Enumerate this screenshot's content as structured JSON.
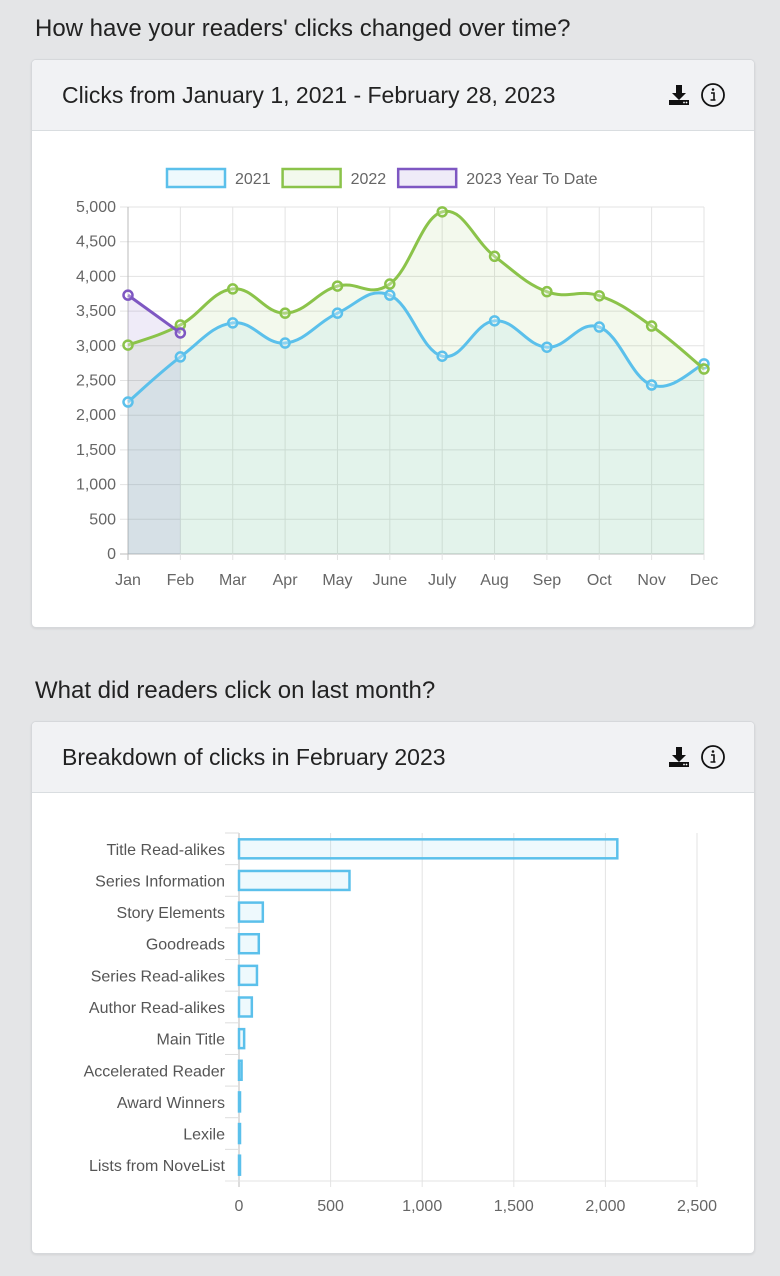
{
  "sections": [
    {
      "heading": "How have your readers' clicks changed over time?",
      "card_title": "Clicks from January 1, 2021 - February 28, 2023",
      "icons": [
        "download-icon",
        "info-icon"
      ]
    },
    {
      "heading": "What did readers click on last month?",
      "card_title": "Breakdown of clicks in February 2023",
      "icons": [
        "download-icon",
        "info-icon"
      ]
    }
  ],
  "chart_data": [
    {
      "type": "line",
      "title": "Clicks from January 1, 2021 - February 28, 2023",
      "xlabel": "",
      "ylabel": "",
      "categories": [
        "Jan",
        "Feb",
        "Mar",
        "Apr",
        "May",
        "June",
        "July",
        "Aug",
        "Sep",
        "Oct",
        "Nov",
        "Dec"
      ],
      "ylim": [
        0,
        5000
      ],
      "yticks": [
        "0",
        "500",
        "1,000",
        "1,500",
        "2,000",
        "2,500",
        "3,000",
        "3,500",
        "4,000",
        "4,500",
        "5,000"
      ],
      "grid": true,
      "legend": "top-center",
      "series": [
        {
          "name": "2021",
          "color": "#5bc0eb",
          "fill": "rgba(91,192,235,0.10)",
          "values": [
            2190,
            2840,
            3330,
            3040,
            3470,
            3730,
            2850,
            3360,
            2980,
            3270,
            2435,
            2740
          ]
        },
        {
          "name": "2022",
          "color": "#8bc34a",
          "fill": "rgba(139,195,74,0.10)",
          "values": [
            3010,
            3300,
            3820,
            3470,
            3860,
            3890,
            4930,
            4290,
            3780,
            3720,
            3285,
            2665
          ]
        },
        {
          "name": "2023 Year To Date",
          "color": "#7e57c2",
          "fill": "rgba(126,87,194,0.12)",
          "values": [
            3730,
            3185
          ]
        }
      ]
    },
    {
      "type": "bar",
      "orientation": "horizontal",
      "title": "Breakdown of clicks in February 2023",
      "xlabel": "",
      "ylabel": "",
      "categories": [
        "Title Read-alikes",
        "Series Information",
        "Story Elements",
        "Goodreads",
        "Series Read-alikes",
        "Author Read-alikes",
        "Main Title",
        "Accelerated Reader",
        "Award Winners",
        "Lexile",
        "Lists from NoveList"
      ],
      "values": [
        2065,
        603,
        130,
        108,
        98,
        70,
        28,
        14,
        5,
        2,
        1
      ],
      "xlim": [
        0,
        2500
      ],
      "xticks": [
        "0",
        "500",
        "1,000",
        "1,500",
        "2,000",
        "2,500"
      ],
      "grid": true,
      "color": "#5bc0eb",
      "fill": "rgba(91,192,235,0.10)"
    }
  ]
}
